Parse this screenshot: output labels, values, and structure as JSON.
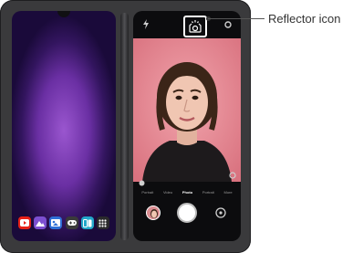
{
  "callout": {
    "label": "Reflector icon"
  },
  "left_screen": {
    "dock_apps": [
      {
        "name": "youtube-icon",
        "color": "#e62117"
      },
      {
        "name": "photos-icon",
        "color": "#7c4fd0"
      },
      {
        "name": "gallery-icon",
        "color": "#2e6fd6"
      },
      {
        "name": "games-icon",
        "color": "#3a3a3a"
      },
      {
        "name": "split-screen-icon",
        "color": "#22a7c9"
      },
      {
        "name": "app-drawer-icon",
        "color": "#2a2a2c"
      }
    ]
  },
  "camera": {
    "modes": [
      "Portrait",
      "Video",
      "Photo",
      "Portrait",
      "More"
    ],
    "active_mode": "Photo",
    "viewfinder_color": "#e48a94",
    "icons": {
      "flash": "flash-off-icon",
      "reflector": "reflector-icon",
      "settings": "settings-icon",
      "timer": "timer-icon",
      "shutter": "shutter-button",
      "switch": "switch-camera-icon"
    }
  }
}
